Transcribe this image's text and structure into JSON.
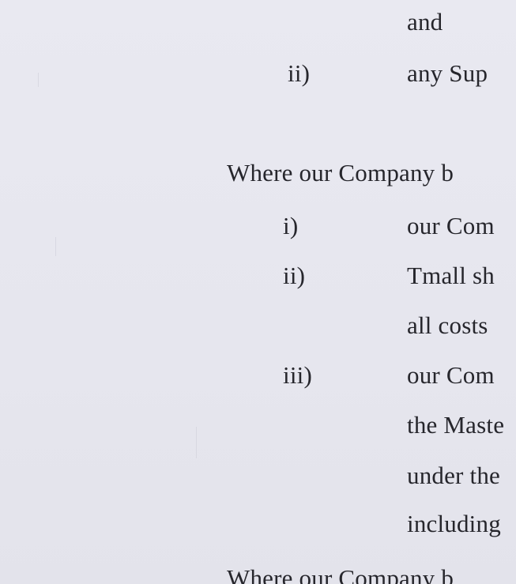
{
  "lines": [
    "and",
    "ii)",
    "any Sup",
    "Where our Company b",
    "i)",
    "our Com",
    "ii)",
    "Tmall sh",
    "all costs",
    "iii)",
    "our Com",
    "the Maste",
    "under the",
    "including",
    "Where our Company b"
  ]
}
